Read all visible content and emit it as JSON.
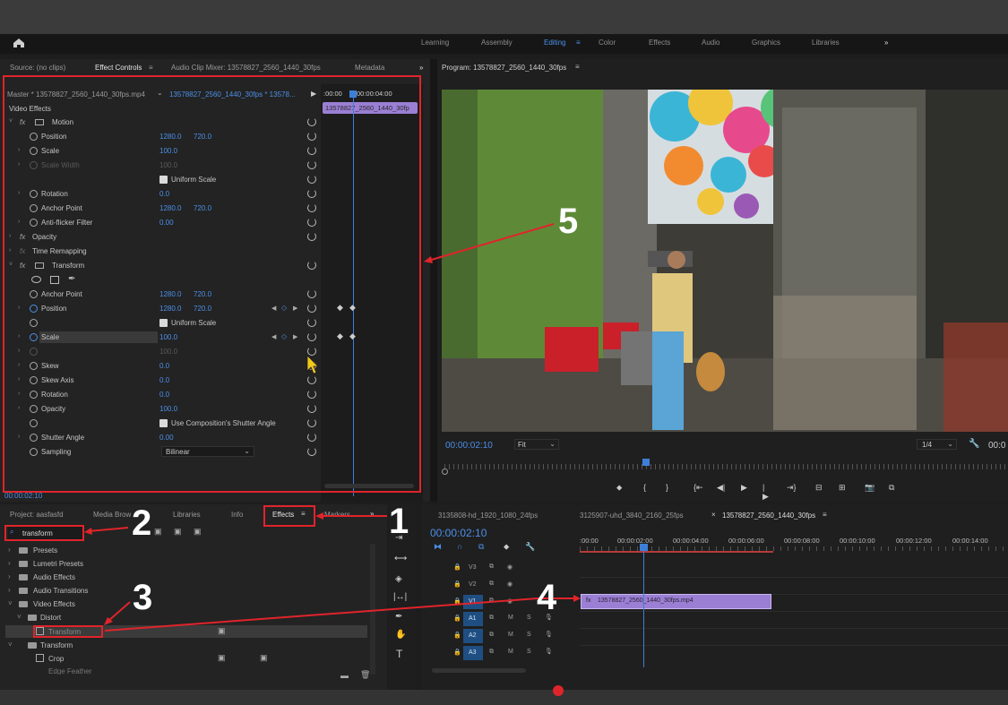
{
  "workspace_tabs": [
    "Learning",
    "Assembly",
    "Editing",
    "Color",
    "Effects",
    "Audio",
    "Graphics",
    "Libraries"
  ],
  "active_workspace": "Editing",
  "source_panel": {
    "tabs": [
      "Source: (no clips)",
      "Effect Controls",
      "Audio Clip Mixer: 13578827_2560_1440_30fps",
      "Metadata"
    ],
    "master_label": "Master * 13578827_2560_1440_30fps.mp4",
    "seq_clip_label": "13578827_2560_1440_30fps * 13578...",
    "ruler_start": ":00:00",
    "ruler_mid": "00:00:04:00",
    "mini_clip": "13578827_2560_1440_30fp",
    "video_effects_label": "Video Effects",
    "current_time": "00:00:02:10",
    "rows": [
      {
        "label": "Motion",
        "fx": true
      },
      {
        "label": "Position",
        "v1": "1280.0",
        "v2": "720.0"
      },
      {
        "label": "Scale",
        "v1": "100.0"
      },
      {
        "label": "Scale Width",
        "v1": "100.0",
        "dim": true
      },
      {
        "label": "Uniform Scale",
        "checkbox": true
      },
      {
        "label": "Rotation",
        "v1": "0.0"
      },
      {
        "label": "Anchor Point",
        "v1": "1280.0",
        "v2": "720.0"
      },
      {
        "label": "Anti-flicker Filter",
        "v1": "0.00"
      },
      {
        "label": "Opacity",
        "fx": true
      },
      {
        "label": "Time Remapping",
        "fx": true
      },
      {
        "label": "Transform",
        "fx": true
      },
      {
        "label": "",
        "shapes": true
      },
      {
        "label": "Anchor Point",
        "v1": "1280.0",
        "v2": "720.0"
      },
      {
        "label": "Position",
        "v1": "1280.0",
        "v2": "720.0",
        "kf": true
      },
      {
        "label": "Uniform Scale",
        "checkbox": true
      },
      {
        "label": "Scale",
        "v1": "100.0",
        "kf": true,
        "highlight": true
      },
      {
        "label": "",
        "v1": "100.0",
        "dim": true
      },
      {
        "label": "Skew",
        "v1": "0.0"
      },
      {
        "label": "Skew Axis",
        "v1": "0.0"
      },
      {
        "label": "Rotation",
        "v1": "0.0"
      },
      {
        "label": "Opacity",
        "v1": "100.0"
      },
      {
        "label": "Use Composition's Shutter Angle",
        "checkbox": true
      },
      {
        "label": "Shutter Angle",
        "v1": "0.00"
      },
      {
        "label": "Sampling",
        "select": "Bilinear"
      }
    ]
  },
  "program_panel": {
    "title": "Program: 13578827_2560_1440_30fps",
    "timecode": "00:00:02:10",
    "fit": "Fit",
    "resolution": "1/4",
    "end_tc": "00:0"
  },
  "project_panel": {
    "tabs": [
      "Project: aasfasfd",
      "Media Brow",
      "Libraries",
      "Info",
      "Effects",
      "Markers"
    ],
    "active_tab": "Effects",
    "search_value": "transform",
    "tree": [
      {
        "label": "Presets",
        "depth": 0
      },
      {
        "label": "Lumetri Presets",
        "depth": 0
      },
      {
        "label": "Audio Effects",
        "depth": 0
      },
      {
        "label": "Audio Transitions",
        "depth": 0
      },
      {
        "label": "Video Effects",
        "depth": 0
      },
      {
        "label": "Distort",
        "depth": 1
      },
      {
        "label": "Transform",
        "depth": 2,
        "selected": true
      },
      {
        "label": "Transform",
        "depth": 1
      },
      {
        "label": "Crop",
        "depth": 2
      },
      {
        "label": "Edge Feather",
        "depth": 2
      }
    ]
  },
  "sequence_panel": {
    "tabs": [
      "3135808-hd_1920_1080_24fps",
      "3125907-uhd_3840_2160_25fps",
      "13578827_2560_1440_30fps"
    ],
    "timecode": "00:00:02:10",
    "ruler": [
      ":00:00",
      "00:00:02:00",
      "00:00:04:00",
      "00:00:06:00",
      "00:00:08:00",
      "00:00:10:00",
      "00:00:12:00",
      "00:00:14:00"
    ],
    "tracks": [
      "V3",
      "V2",
      "V1",
      "A1",
      "A2",
      "A3"
    ],
    "clip_label": "13578827_2560_1440_30fps.mp4"
  },
  "annotations": [
    "1",
    "2",
    "3",
    "4",
    "5"
  ],
  "colors": {
    "accent": "#4c8fe8",
    "annotation": "#e0242b",
    "clip": "#9b7fd4"
  }
}
